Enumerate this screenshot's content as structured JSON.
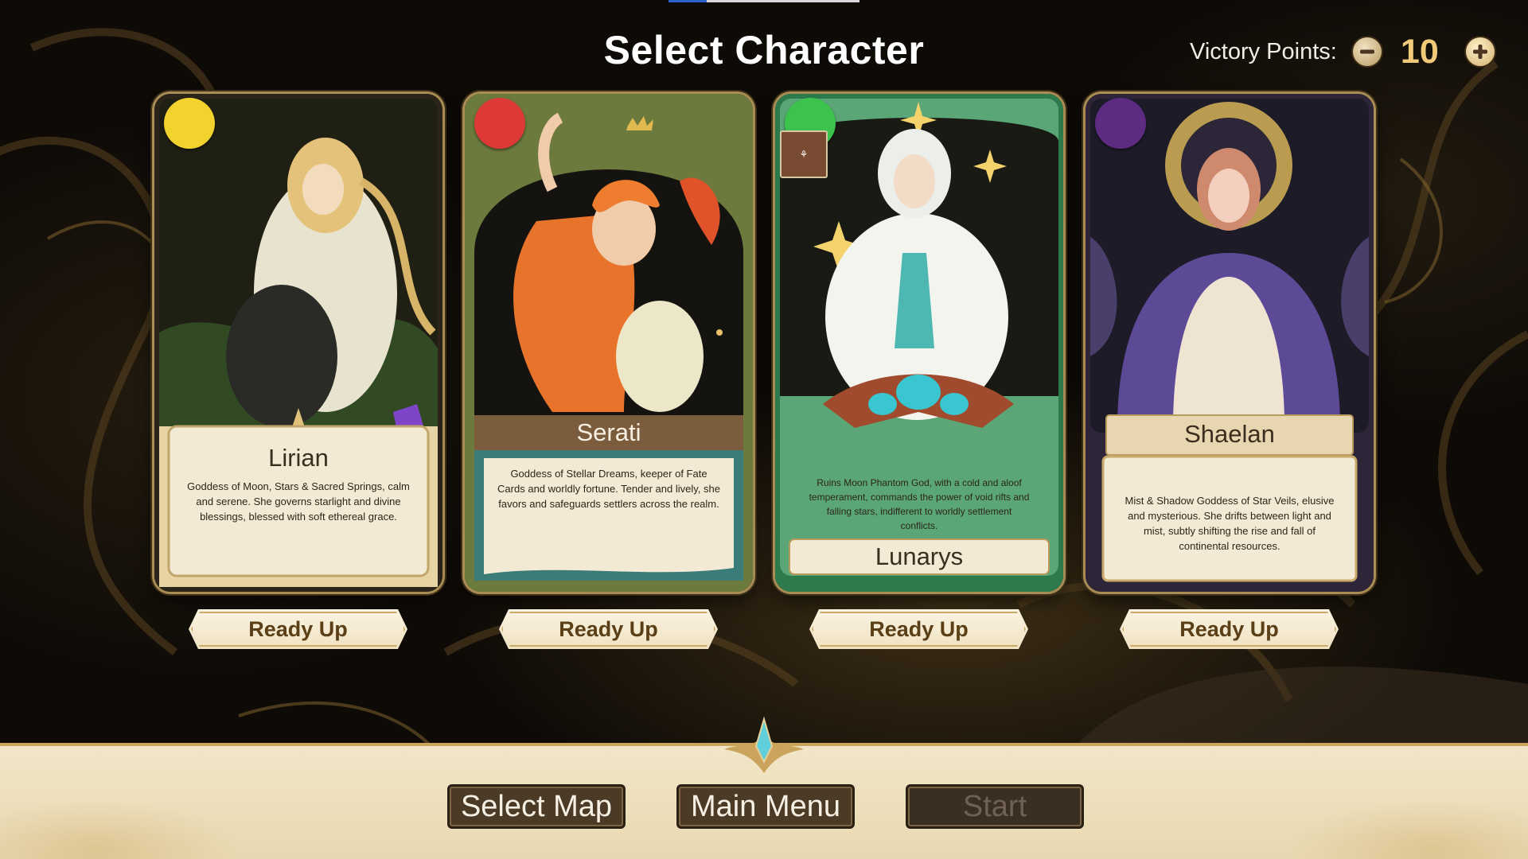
{
  "screen": {
    "title": "Select Character"
  },
  "victory_points": {
    "label": "Victory Points:",
    "value": "10",
    "decrease_icon": "minus-circle-icon",
    "increase_icon": "plus-circle-icon"
  },
  "characters": [
    {
      "name": "Lirian",
      "player_color": "#f2d22c",
      "description": "Goddess of Moon, Stars & Sacred Springs, calm and serene. She governs starlight and divine blessings, blessed with soft ethereal grace.",
      "ready_label": "Ready Up"
    },
    {
      "name": "Serati",
      "player_color": "#dd3a37",
      "description": "Goddess of Stellar Dreams, keeper of Fate Cards and worldly fortune. Tender and lively, she favors and safeguards settlers across the realm.",
      "ready_label": "Ready Up"
    },
    {
      "name": "Lunarys",
      "player_color": "#3cc34d",
      "description": "Ruins Moon Phantom God, with a cold and aloof temperament, commands the power of void rifts and falling stars, indifferent to worldly settlement conflicts.",
      "ready_label": "Ready Up"
    },
    {
      "name": "Shaelan",
      "player_color": "#5d2c82",
      "description": "Mist & Shadow Goddess of Star Veils, elusive and mysterious. She drifts between light and mist, subtly shifting the rise and fall of continental resources.",
      "ready_label": "Ready Up"
    }
  ],
  "bottom_bar": {
    "select_map_label": "Select Map",
    "main_menu_label": "Main Menu",
    "start_label": "Start",
    "start_enabled": false
  },
  "colors": {
    "title_text": "#ffffff",
    "vp_value": "#f0c979",
    "button_dark": "#4a3a26",
    "parchment": "#f3ead5",
    "gold_trim": "#c9a45a"
  }
}
